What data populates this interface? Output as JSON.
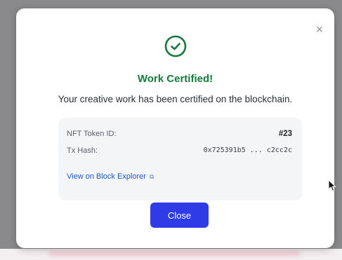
{
  "modal": {
    "close_icon_glyph": "×",
    "title": "Work Certified!",
    "subtitle": "Your creative work has been certified on the blockchain.",
    "success_icon": "check-circle-icon",
    "accent_green": "#167a3d",
    "info": {
      "token_label": "NFT Token ID:",
      "token_value": "#23",
      "hash_label": "Tx Hash:",
      "hash_value": "0x725391b5 ... c2cc2c",
      "explorer_link": "View on Block Explorer",
      "external_icon_glyph": "⧉"
    },
    "close_button": "Close",
    "button_color": "#2f3be6"
  }
}
